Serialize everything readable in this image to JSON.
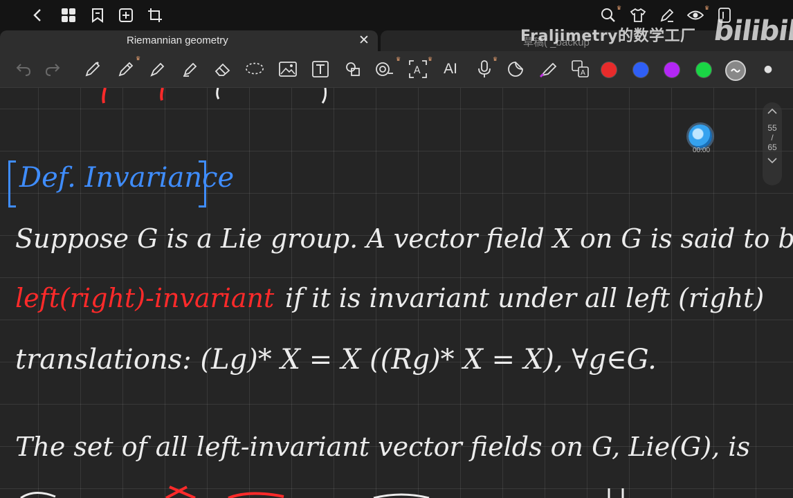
{
  "system_bar": {
    "icons": [
      "back-chevron-icon",
      "grid-icon",
      "bookmark-icon",
      "add-page-icon",
      "crop-icon",
      "search-icon",
      "shirt-icon",
      "pen-icon",
      "eye-icon",
      "phone-icon",
      "more-icon"
    ]
  },
  "tabs": [
    {
      "label": "Riemannian geometry",
      "active": true
    },
    {
      "label": "草稿( _backup",
      "active": false
    }
  ],
  "watermark": {
    "uploader": "Fraljimetry的数学工厂",
    "logo": "bilibili"
  },
  "toolbar": {
    "tools": [
      "undo-icon",
      "redo-icon",
      "pen-icon",
      "pencil-icon",
      "fine-pen-icon",
      "highlighter-icon",
      "eraser-icon",
      "lasso-icon",
      "image-icon",
      "text-icon",
      "shapes-icon",
      "tape-icon",
      "ocr-icon",
      "ai-icon",
      "mic-icon",
      "sticker-icon",
      "laser-pointer-icon",
      "translate-icon"
    ],
    "ai_label": "AI",
    "colors": [
      "#e82b2b",
      "#2f5ff5",
      "#b327f5",
      "#1ad545",
      "#888888"
    ]
  },
  "canvas": {
    "heading": "Def. Invariance",
    "line1": "Suppose G is a Lie group. A vector field X on G is said to be",
    "line2_red": "left(right)-invariant",
    "line2_rest": "if it is invariant under all left (right)",
    "line3": "translations: (Lg)* X = X ((Rg)* X = X), ∀g∈G.",
    "line4": "The set of all left-invariant vector fields on G, Lie(G), is"
  },
  "pager": {
    "current": "55",
    "separator": "/",
    "total": "65"
  },
  "recording": {
    "time": "00:00"
  }
}
